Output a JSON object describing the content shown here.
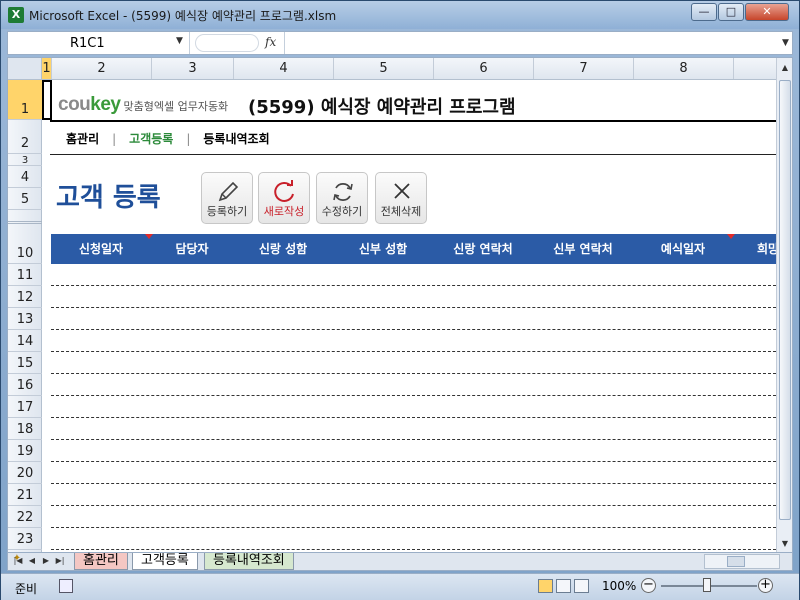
{
  "window": {
    "title": "Microsoft Excel - (5599) 예식장 예약관리 프로그램.xlsm",
    "app_icon": "X",
    "minimize": "—",
    "maximize": "□",
    "close": "✕"
  },
  "formula_bar": {
    "name_box": "R1C1",
    "fx": "fx",
    "formula": ""
  },
  "columns": [
    "1",
    "2",
    "3",
    "4",
    "5",
    "6",
    "7",
    "8"
  ],
  "rows": [
    "1",
    "2",
    "3",
    "4",
    "5",
    "10",
    "11",
    "12",
    "13",
    "14",
    "15",
    "16",
    "17",
    "18",
    "19",
    "20",
    "21",
    "22",
    "23"
  ],
  "logo": {
    "brand_cou": "cou",
    "brand_key": "key",
    "tagline": "맞춤형엑셀 업무자동화"
  },
  "doc_title": "(5599) 예식장 예약관리 프로그램",
  "nav": {
    "home": "홈관리",
    "register": "고객등록",
    "history": "등록내역조회",
    "separator": "|"
  },
  "page_heading": "고객 등록",
  "actions": {
    "register": "등록하기",
    "new": "새로작성",
    "edit": "수정하기",
    "delete_all": "전체삭제"
  },
  "table": {
    "headers": [
      "신청일자",
      "담당자",
      "신랑 성함",
      "신부 성함",
      "신랑 연락처",
      "신부 연락처",
      "예식일자",
      "희망"
    ]
  },
  "sheet_tabs": {
    "home": "홈관리",
    "register": "고객등록",
    "history": "등록내역조회"
  },
  "status": {
    "ready": "준비",
    "zoom": "100%",
    "zoom_minus": "−",
    "zoom_plus": "+"
  },
  "colors": {
    "header_blue": "#2b5ba6",
    "heading_blue": "#1f4f99",
    "brand_green": "#3a9a3a",
    "nav_active": "#2c8a3a",
    "new_label_red": "#c8202a"
  }
}
